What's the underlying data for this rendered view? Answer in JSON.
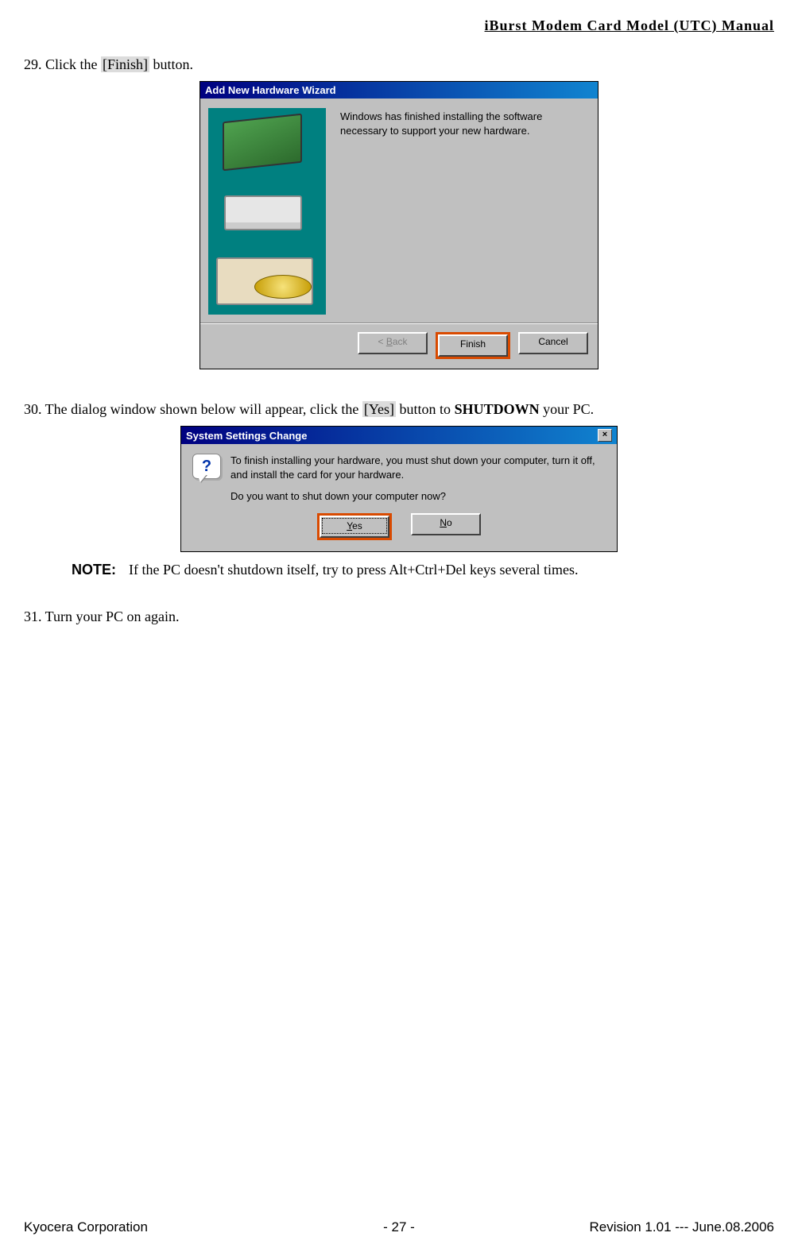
{
  "header": {
    "title": "iBurst  Modem  Card  Model  (UTC)  Manual"
  },
  "step29": {
    "prefix": "29. Click the ",
    "label": "[Finish]",
    "suffix": " button."
  },
  "dialog1": {
    "title": "Add New Hardware Wizard",
    "body_text": "Windows has finished installing the software necessary to support your new hardware.",
    "back_label": "< Back",
    "finish_label": "Finish",
    "cancel_label": "Cancel"
  },
  "step30": {
    "prefix": "30. The dialog window shown below will appear, click the ",
    "label": "[Yes]",
    "mid": " button to ",
    "bold": "SHUTDOWN",
    "suffix": " your PC."
  },
  "dialog2": {
    "title": "System Settings Change",
    "line1": "To finish installing your hardware, you must shut down your computer, turn it off, and install the card for your hardware.",
    "line2": "Do you want to shut down your computer now?",
    "yes_pre": "",
    "yes_u": "Y",
    "yes_post": "es",
    "no_u": "N",
    "no_post": "o"
  },
  "note": {
    "label": "NOTE:",
    "text": "If the PC doesn't shutdown itself, try to press Alt+Ctrl+Del keys several times."
  },
  "step31": {
    "text": "31. Turn your PC on again."
  },
  "footer": {
    "left": "Kyocera Corporation",
    "center": "- 27 -",
    "right": "Revision 1.01 --- June.08.2006"
  },
  "icons": {
    "question": "?",
    "close": "×"
  }
}
